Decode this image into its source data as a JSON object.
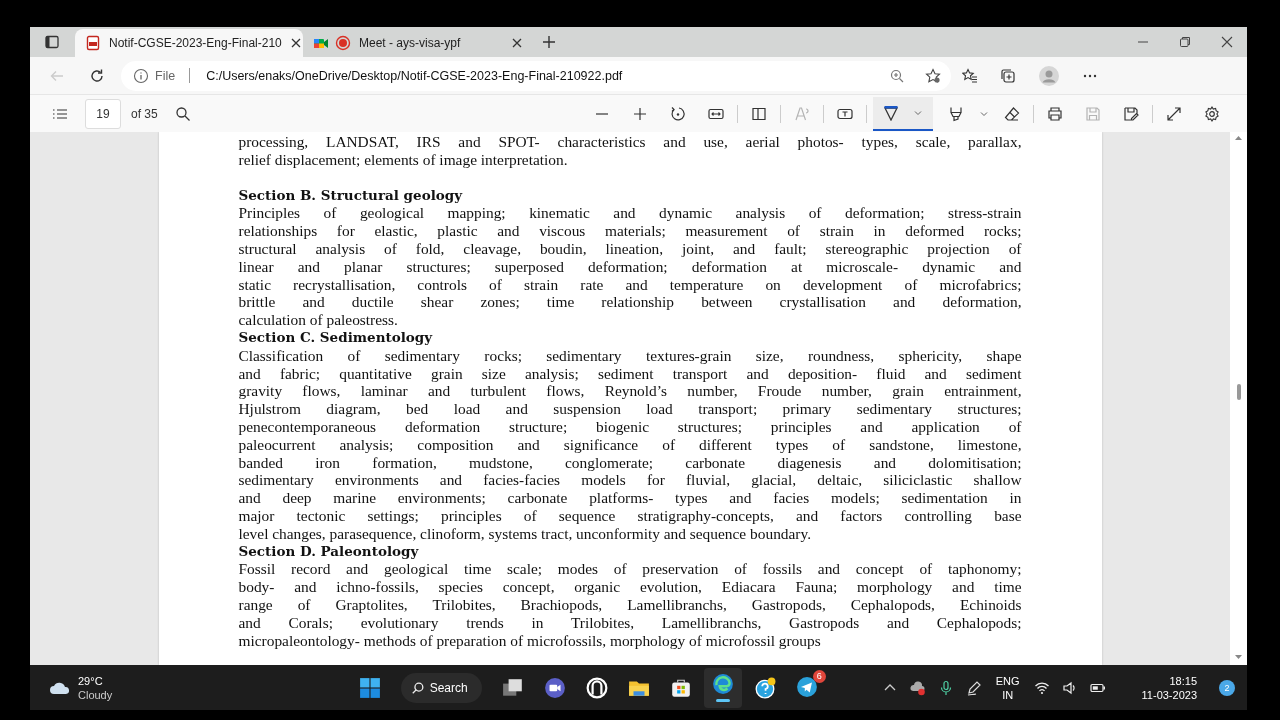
{
  "tabs": [
    {
      "title": "Notif-CGSE-2023-Eng-Final-210",
      "selected": true
    },
    {
      "title": "Meet - ays-visa-ypf",
      "selected": false
    }
  ],
  "address_bar": {
    "scheme_label": "File",
    "url": "C:/Users/enaks/OneDrive/Desktop/Notif-CGSE-2023-Eng-Final-210922.pdf"
  },
  "pdf_toolbar": {
    "page_number": "19",
    "page_count": "of 35",
    "draw_tool": {
      "selected": true
    },
    "read_aloud": {
      "disabled": true
    },
    "save": {
      "disabled": true
    }
  },
  "document": {
    "blocks": [
      {
        "kind": "paragraph",
        "lines": [
          "processing, LANDSAT, IRS and SPOT- characteristics and use, aerial photos- types, scale, parallax,",
          "relief displacement; elements of image interpretation."
        ]
      },
      {
        "kind": "spacer"
      },
      {
        "kind": "heading",
        "text": "Section B. Structural geology"
      },
      {
        "kind": "paragraph",
        "lines": [
          "Principles of geological mapping; kinematic and dynamic analysis of deformation; stress-strain",
          "relationships for elastic, plastic and viscous materials; measurement of strain in deformed rocks;",
          "structural analysis of fold, cleavage, boudin, lineation, joint, and fault; stereographic projection of",
          "linear and planar structures; superposed deformation; deformation at microscale- dynamic and",
          "static recrystallisation, controls of strain rate and temperature on development of microfabrics;",
          "brittle and ductile shear zones; time relationship between crystallisation and deformation,",
          "calculation of paleostress."
        ]
      },
      {
        "kind": "heading",
        "text": "Section C.  Sedimentology"
      },
      {
        "kind": "paragraph",
        "lines": [
          "Classification of sedimentary rocks; sedimentary textures-grain size, roundness, sphericity, shape",
          "and fabric; quantitative grain size analysis; sediment transport and deposition- fluid and sediment",
          "gravity flows, laminar and turbulent flows, Reynold’s number, Froude number, grain entrainment,",
          "Hjulstrom diagram, bed load and suspension load transport; primary sedimentary structures;",
          "penecontemporaneous deformation structure; biogenic structures; principles and application of",
          "paleocurrent analysis; composition and significance of different types of sandstone, limestone,",
          "banded iron formation, mudstone, conglomerate; carbonate diagenesis and dolomitisation;",
          "sedimentary environments and facies-facies models for fluvial, glacial, deltaic, siliciclastic shallow",
          "and deep marine environments; carbonate platforms- types and facies models; sedimentation in",
          "major tectonic settings; principles of sequence stratigraphy-concepts, and factors controlling base",
          "level changes, parasequence, clinoform, systems tract, unconformity and sequence boundary."
        ]
      },
      {
        "kind": "heading",
        "text": "Section D.  Paleontology"
      },
      {
        "kind": "paragraph",
        "lines": [
          "Fossil record  and geological time scale; modes of preservation of fossils and concept of taphonomy;",
          "body- and ichno-fossils, species concept, organic evolution, Ediacara Fauna; morphology and time",
          "range of Graptolites, Trilobites, Brachiopods, Lamellibranchs, Gastropods, Cephalopods, Echinoids",
          "and Corals; evolutionary trends in Trilobites, Lamellibranchs, Gastropods and Cephalopods;",
          "micropaleontology-  methods of preparation of microfossils, morphology of microfossil groups"
        ]
      }
    ]
  },
  "taskbar": {
    "weather": {
      "temperature": "29°C",
      "condition": "Cloudy"
    },
    "search_label": "Search",
    "telegram_badge": "6",
    "language": "ENG",
    "region": "IN",
    "time": "18:15",
    "date": "11-03-2023",
    "notification_count": "2"
  }
}
